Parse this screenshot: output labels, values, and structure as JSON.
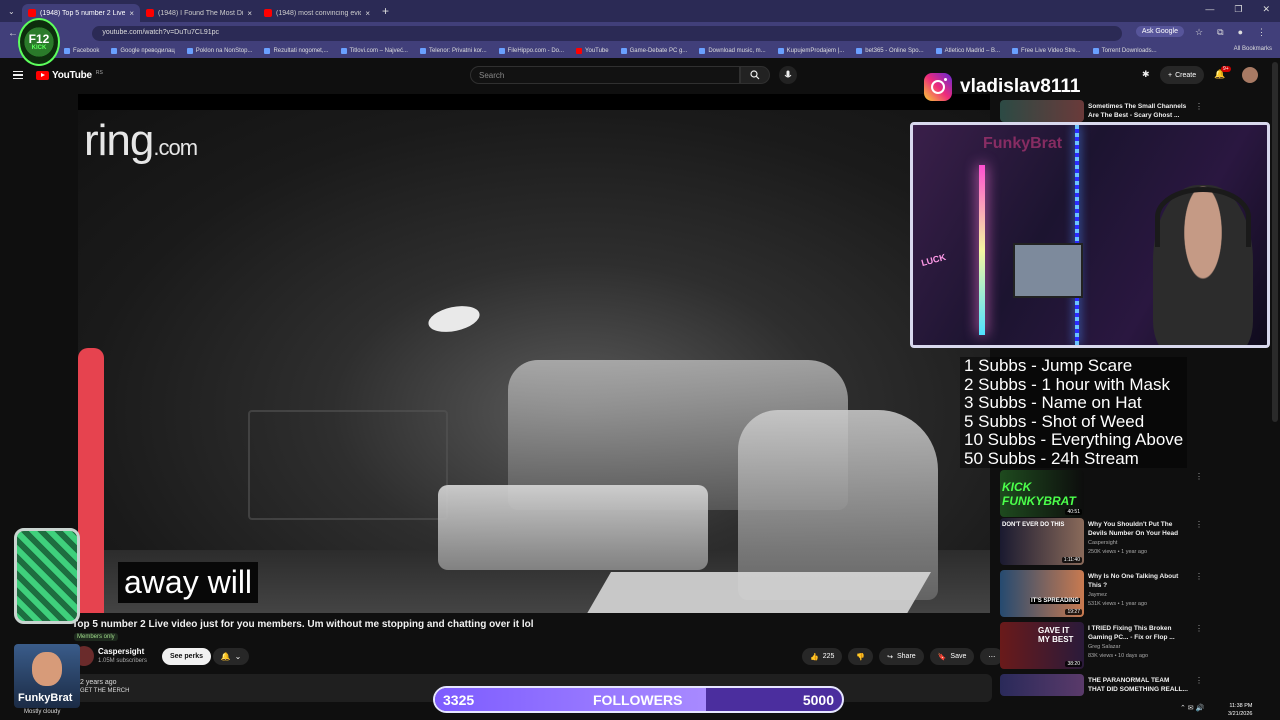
{
  "browser": {
    "tabs": [
      {
        "title": "(1948) Top 5 number 2 Live",
        "active": true
      },
      {
        "title": "(1948) I Found The Most Distu",
        "active": false
      },
      {
        "title": "(1948) most convincing eviden",
        "active": false
      }
    ],
    "url": "youtube.com/watch?v=DuTu7CL91pc",
    "ask_google": "Ask Google",
    "bookmarks": [
      "Facebook",
      "Google преводилац",
      "Poklon na NonStop...",
      "Rezultati nogomet,...",
      "Titlovi.com – Najveć...",
      "Telenor: Privatni kor...",
      "FileHippo.com - Do...",
      "YouTube",
      "Game-Debate PC g...",
      "Download music, m...",
      "KupujemProdajem |...",
      "bet365 - Online Spo...",
      "Atletico Madrid – B...",
      "Free Live Video Stre...",
      "Torrent Downloads..."
    ],
    "all_bookmarks": "All Bookmarks"
  },
  "youtube": {
    "logo_text": "YouTube",
    "logo_suffix": "RS",
    "search_placeholder": "Search",
    "create_label": "Create",
    "notif_count": "9+"
  },
  "overlay": {
    "instagram_handle": "vladislav8111",
    "f12_line1": "F12",
    "f12_line2": "KICK",
    "funky_name": "FunkyBrat",
    "subs_rewards": [
      "1 Subbs - Jump Scare",
      "2 Subbs - 1 hour with Mask",
      "3 Subbs - Name on Hat",
      "5 Subbs - Shot of Weed",
      "10 Subbs - Everything Above",
      "50 Subbs - 24h Stream"
    ],
    "followers": {
      "current": "3325",
      "label": "FOLLOWERS",
      "goal": "5000",
      "progress": 0.665
    },
    "webcam_brand": "FunkyBrat",
    "neon_sign": "LUCK"
  },
  "video": {
    "watermark": "ring",
    "watermark_domain": ".com",
    "caption": "away will",
    "title": "Top 5 number 2 Live video just for you members. Um without me stopping and chatting over it lol",
    "members_badge": "Members only",
    "channel": "Caspersight",
    "subscribers": "1.05M subscribers",
    "see_perks": "See perks",
    "likes": "225",
    "share": "Share",
    "save": "Save",
    "date": "2 years ago",
    "merch": "GET THE MERCH"
  },
  "recommendations": [
    {
      "title": "Sometimes The Small Channels Are The Best - Scary Ghost ...",
      "channel": "",
      "meta": "",
      "duration": ""
    },
    {
      "title": "",
      "channel": "",
      "meta": "",
      "duration": "40:51"
    },
    {
      "title": "Why You Shouldn't Put The Devils Number On Your Head",
      "channel": "Caspersight",
      "meta": "250K views • 1 year ago",
      "duration": "1:11:40"
    },
    {
      "title": "Why Is No One Talking About This ?",
      "channel": "Jaymez",
      "meta": "531K views • 1 year ago",
      "duration": "19:27"
    },
    {
      "title": "I TRIED Fixing This Broken Gaming PC... - Fix or Flop ...",
      "channel": "Greg Salazar",
      "meta": "83K views • 10 days ago",
      "duration": "38:20"
    },
    {
      "title": "THE PARANORMAL TEAM THAT DID SOMETHING REALL...",
      "channel": "",
      "meta": "",
      "duration": ""
    }
  ],
  "rec_thumb_text": {
    "kick": "KICK FUNKYBRAT",
    "never": "DON'T EVER DO THIS",
    "spreading": "IT'S SPREADING",
    "gave": "GAVE IT MY BEST"
  },
  "taskbar": {
    "weather": "Mostly cloudy",
    "time": "11:38 PM",
    "date": "3/21/2026"
  },
  "colors": {
    "accent_red": "#ff0000",
    "browser_bg": "#413f7a",
    "followers_fill": "#7d5cff"
  }
}
